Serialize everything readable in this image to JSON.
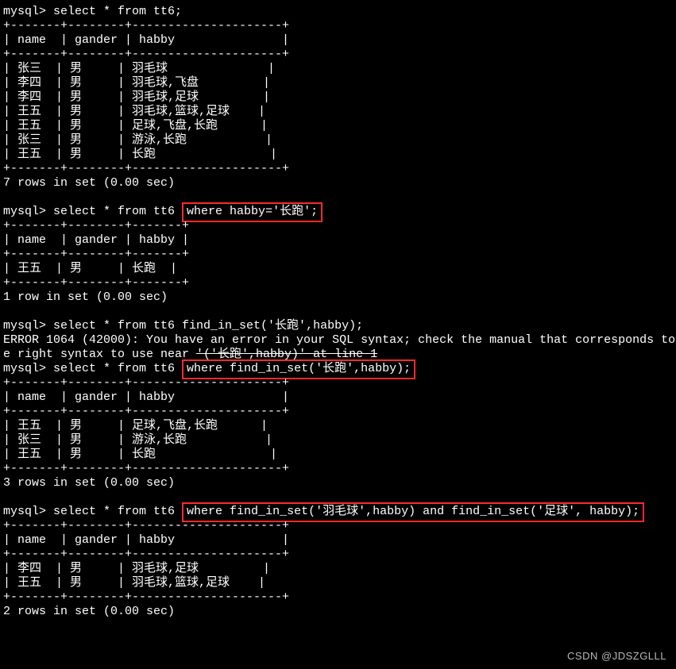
{
  "prompt": "mysql> ",
  "sep3_narrow": "+-------+--------+-------+",
  "sep3_wide": "+-------+--------+---------------------+",
  "queries": {
    "q1": "select * from tt6;",
    "q2_pre": "select * from tt6 ",
    "q2_hi": "where habby='长跑';",
    "q3": "select * from tt6 find_in_set('长跑',habby);",
    "q4_pre": "select * from tt6 ",
    "q4_hi": "where find_in_set('长跑',habby);",
    "q5_pre": "select * from tt6 ",
    "q5_hi": "where find_in_set('羽毛球',habby) and find_in_set('足球', habby);"
  },
  "headers": {
    "name": "name",
    "gander": "gander",
    "habby": "habby"
  },
  "table1": [
    {
      "name": "张三",
      "gander": "男",
      "habby": "羽毛球"
    },
    {
      "name": "李四",
      "gander": "男",
      "habby": "羽毛球,飞盘"
    },
    {
      "name": "李四",
      "gander": "男",
      "habby": "羽毛球,足球"
    },
    {
      "name": "王五",
      "gander": "男",
      "habby": "羽毛球,篮球,足球"
    },
    {
      "name": "王五",
      "gander": "男",
      "habby": "足球,飞盘,长跑"
    },
    {
      "name": "张三",
      "gander": "男",
      "habby": "游泳,长跑"
    },
    {
      "name": "王五",
      "gander": "男",
      "habby": "长跑"
    }
  ],
  "table1_footer": "7 rows in set (0.00 sec)",
  "table2": [
    {
      "name": "王五",
      "gander": "男",
      "habby": "长跑"
    }
  ],
  "table2_footer": "1 row in set (0.00 sec)",
  "error_line1": "ERROR 1064 (42000): You have an error in your SQL syntax; check the manual that corresponds to",
  "error_line2_pre": "e right syntax to use near ",
  "error_line2_strike": "'('长跑',habby)' at line 1",
  "table3": [
    {
      "name": "王五",
      "gander": "男",
      "habby": "足球,飞盘,长跑"
    },
    {
      "name": "张三",
      "gander": "男",
      "habby": "游泳,长跑"
    },
    {
      "name": "王五",
      "gander": "男",
      "habby": "长跑"
    }
  ],
  "table3_footer": "3 rows in set (0.00 sec)",
  "table4": [
    {
      "name": "李四",
      "gander": "男",
      "habby": "羽毛球,足球"
    },
    {
      "name": "王五",
      "gander": "男",
      "habby": "羽毛球,篮球,足球"
    }
  ],
  "table4_footer": "2 rows in set (0.00 sec)",
  "watermark": "CSDN @JDSZGLLL"
}
